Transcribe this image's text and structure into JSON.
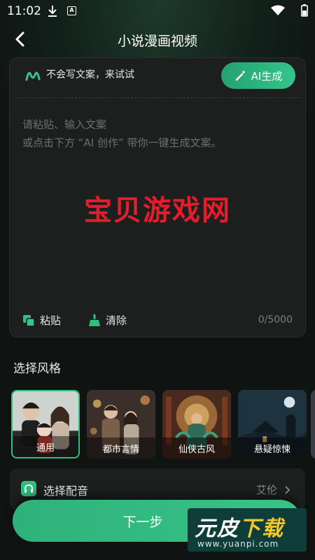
{
  "status_bar": {
    "time": "11:02"
  },
  "header": {
    "title": "小说漫画视频"
  },
  "editor": {
    "prompt_text": "不会写文案，来试试",
    "ai_button_label": "AI生成",
    "placeholder_line1": "请粘贴、输入文案",
    "placeholder_line2": "或点击下方 “AI 创作” 带你一键生成文案。",
    "watermark_text": "宝贝游戏网",
    "paste_label": "粘贴",
    "clear_label": "清除",
    "char_count": "0/5000"
  },
  "style_section": {
    "title": "选择风格",
    "styles": [
      {
        "label": "通用",
        "selected": true
      },
      {
        "label": "都市言情",
        "selected": false
      },
      {
        "label": "仙侠古风",
        "selected": false
      },
      {
        "label": "悬疑惊悚",
        "selected": false
      }
    ]
  },
  "voice": {
    "label": "选择配音",
    "value": "艾伦"
  },
  "next_button": {
    "label": "下一步"
  },
  "brand": {
    "name_part1": "元皮",
    "name_part2": "下载",
    "url": "www.yuanpi.com"
  },
  "colors": {
    "accent": "#2fbf7f",
    "background": "#0f1412",
    "card": "#1c1f1e",
    "watermark_red": "#e61c2a"
  }
}
